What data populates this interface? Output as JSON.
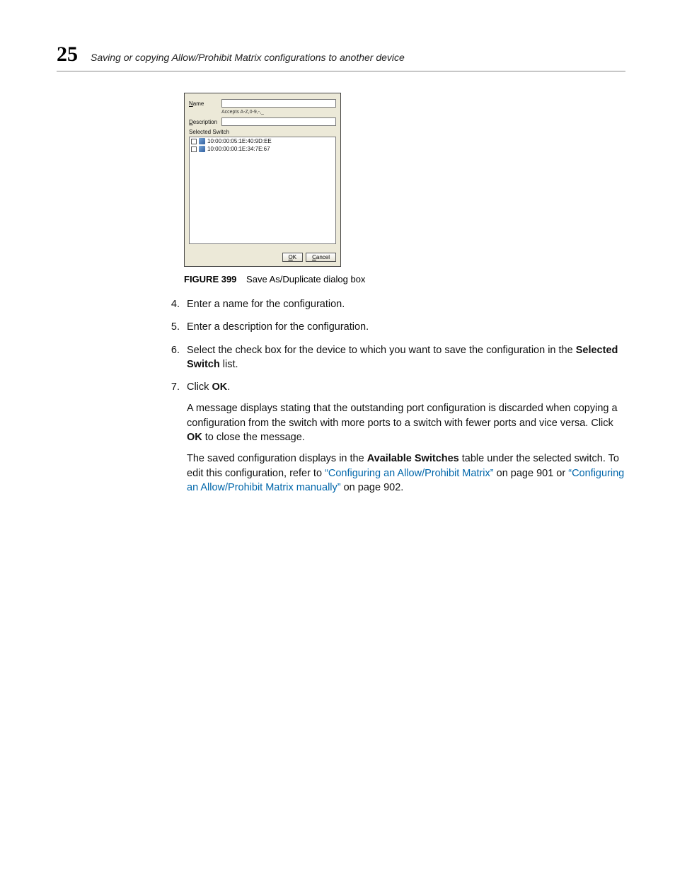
{
  "header": {
    "chapter": "25",
    "title": "Saving or copying Allow/Prohibit Matrix configurations to another device"
  },
  "dialog": {
    "name_label": "Name",
    "accepts_hint": "Accepts A-Z,0-9,-,_",
    "description_label": "Description",
    "selected_switch_label": "Selected Switch",
    "switches": [
      "10:00:00:05:1E:40:9D:EE",
      "10:00:00:00:1E:34:7E:67"
    ],
    "ok_label": "OK",
    "cancel_label": "Cancel"
  },
  "figure": {
    "label": "FIGURE 399",
    "caption": "Save As/Duplicate dialog box"
  },
  "steps": {
    "start": 4,
    "s4": "Enter a name for the configuration.",
    "s5": "Enter a description for the configuration.",
    "s6_a": "Select the check box for the device to which you want to save the configuration in the ",
    "s6_bold": "Selected Switch",
    "s6_b": " list.",
    "s7_a": "Click ",
    "s7_bold": "OK",
    "s7_b": ".",
    "p1_a": "A message displays stating that the outstanding port configuration is discarded when copying a configuration from the switch with more ports to a switch with fewer ports and vice versa. Click ",
    "p1_bold": "OK",
    "p1_b": " to close the message.",
    "p2_a": "The saved configuration displays in the ",
    "p2_bold": "Available Switches",
    "p2_b": " table under the selected switch. To edit this configuration, refer to ",
    "p2_link1": "“Configuring an Allow/Prohibit Matrix”",
    "p2_c": " on page 901 or ",
    "p2_link2": "“Configuring an Allow/Prohibit Matrix manually”",
    "p2_d": " on page 902."
  }
}
